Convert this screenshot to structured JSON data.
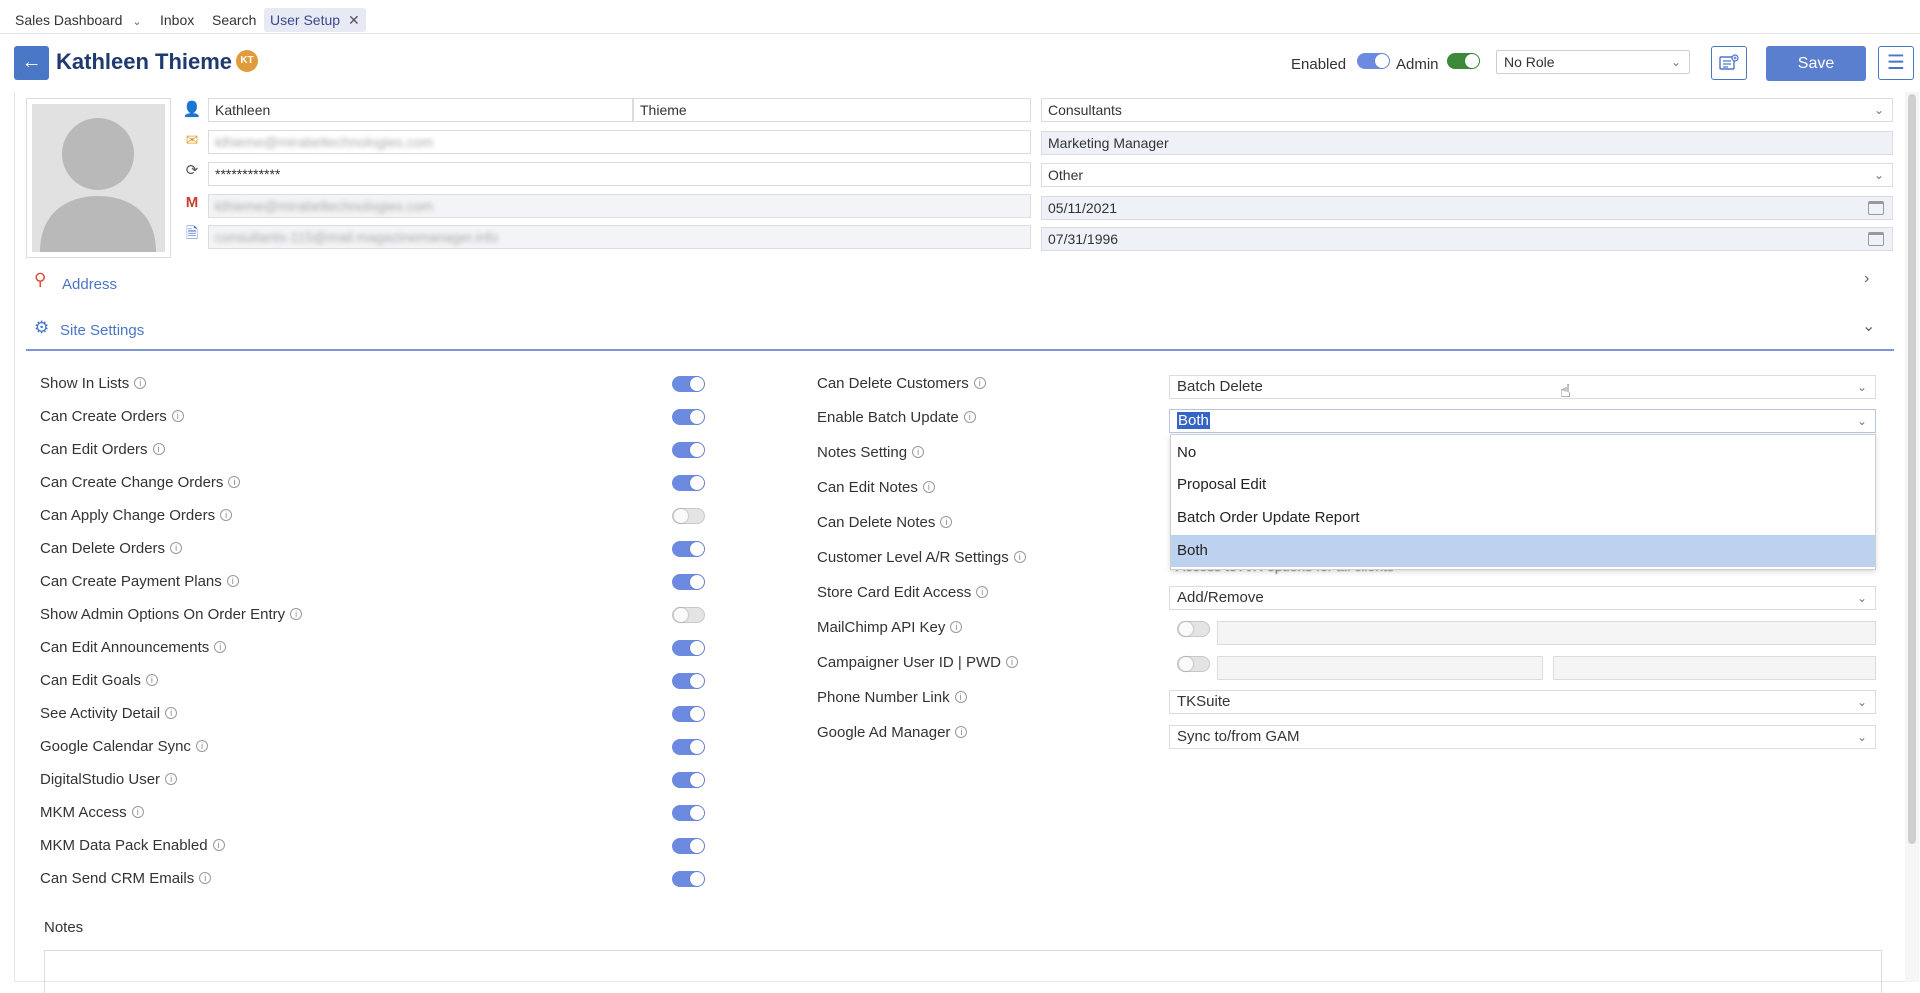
{
  "tabs": [
    {
      "label": "Sales Dashboard",
      "has_dropdown": true,
      "active": false
    },
    {
      "label": "Inbox",
      "active": false
    },
    {
      "label": "Search",
      "active": false
    },
    {
      "label": "User Setup",
      "active": true,
      "closable": true
    }
  ],
  "header": {
    "back_icon": "arrow-left-icon",
    "name": "Kathleen Thieme",
    "initials": "KT",
    "enabled_label": "Enabled",
    "enabled_on": true,
    "admin_label": "Admin",
    "admin_on": true,
    "role_value": "No Role",
    "save_label": "Save",
    "colors": {
      "primary": "#4a76c6",
      "save": "#5a7fcf",
      "admin_toggle": "#3a8a3a",
      "badge": "#e09c3b"
    }
  },
  "profile": {
    "first_name": "Kathleen",
    "last_name": "Thieme",
    "email": "kthieme@mirabeltechnologies.com",
    "password": "************",
    "gmail": "kthieme@mirabeltechnologies.com",
    "alt_email": "consultants-115@mail.magazinemanager.info",
    "department": "Consultants",
    "title": "Marketing Manager",
    "category": "Other",
    "date_1": "05/11/2021",
    "date_2": "07/31/1996"
  },
  "sections": {
    "address": "Address",
    "site_settings": "Site Settings"
  },
  "settings_left": [
    {
      "label": "Show In Lists",
      "on": true
    },
    {
      "label": "Can Create Orders",
      "on": true
    },
    {
      "label": "Can Edit Orders",
      "on": true
    },
    {
      "label": "Can Create Change Orders",
      "on": true
    },
    {
      "label": "Can Apply Change Orders",
      "on": false
    },
    {
      "label": "Can Delete Orders",
      "on": true
    },
    {
      "label": "Can Create Payment Plans",
      "on": true
    },
    {
      "label": "Show Admin Options On Order Entry",
      "on": false
    },
    {
      "label": "Can Edit Announcements",
      "on": true
    },
    {
      "label": "Can Edit Goals",
      "on": true
    },
    {
      "label": "See Activity Detail",
      "on": true
    },
    {
      "label": "Google Calendar Sync",
      "on": true
    },
    {
      "label": "DigitalStudio User",
      "on": true
    },
    {
      "label": "MKM Access",
      "on": true
    },
    {
      "label": "MKM Data Pack Enabled",
      "on": true
    },
    {
      "label": "Can Send CRM Emails",
      "on": true
    }
  ],
  "settings_right": {
    "labels": [
      "Can Delete Customers",
      "Enable Batch Update",
      "Notes Setting",
      "Can Edit Notes",
      "Can Delete Notes",
      "Customer Level A/R Settings",
      "Store Card Edit Access",
      "MailChimp API Key",
      "Campaigner User ID | PWD",
      "Phone Number Link",
      "Google Ad Manager"
    ],
    "can_delete_customers": "Batch Delete",
    "enable_batch_update": "Both",
    "customer_ar_behind": "Access to A/R options for all clients",
    "store_card_edit_access": "Add/Remove",
    "mailchimp_on": false,
    "campaigner_on": false,
    "phone_number_link": "TKSuite",
    "google_ad_manager": "Sync to/from GAM"
  },
  "dropdown": {
    "options": [
      "No",
      "Proposal Edit",
      "Batch Order Update Report",
      "Both"
    ],
    "highlighted": "Both"
  },
  "notes_label": "Notes"
}
